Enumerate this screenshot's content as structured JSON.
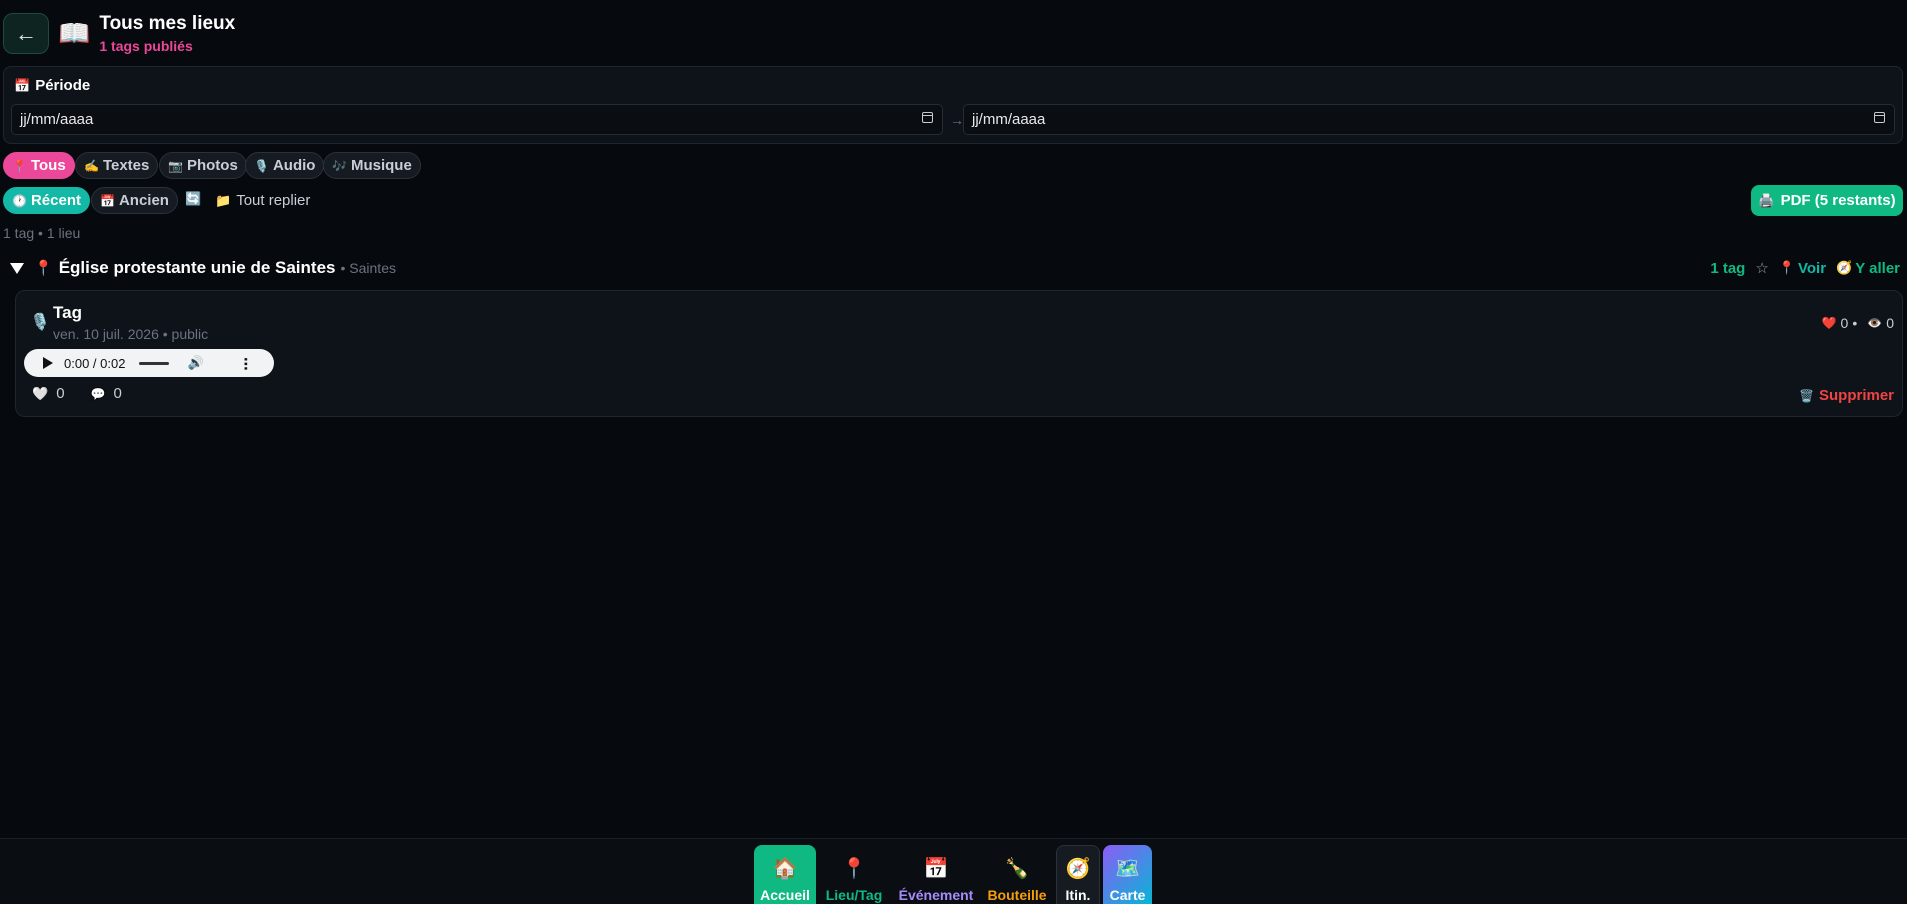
{
  "header": {
    "back_icon": "←",
    "book_icon": "📖",
    "title": "Tous mes lieux",
    "subtitle": "1 tags publiés"
  },
  "period": {
    "icon": "📅",
    "label": "Période",
    "start_value": "jj/mm/aaaa",
    "end_value": "jj/mm/aaaa",
    "separator": "→"
  },
  "type_filters": [
    {
      "icon": "📍",
      "label": "Tous"
    },
    {
      "icon": "✍️",
      "label": "Textes"
    },
    {
      "icon": "📷",
      "label": "Photos"
    },
    {
      "icon": "🎙️",
      "label": "Audio"
    },
    {
      "icon": "🎶",
      "label": "Musique"
    }
  ],
  "sort": {
    "recent": {
      "icon": "🕐",
      "label": "Récent"
    },
    "old": {
      "icon": "📅",
      "label": "Ancien"
    },
    "refresh_icon": "🔄",
    "collapse": {
      "icon": "📁",
      "label": "Tout replier"
    }
  },
  "pdf_button": {
    "icon": "🖨️",
    "label": "PDF (5 restants)"
  },
  "summary": "1 tag • 1 lieu",
  "place": {
    "pin_icon": "📍",
    "name": "Église protestante unie de Saintes",
    "city": "• Saintes",
    "tag_count": "1 tag",
    "star_icon": "☆",
    "view": {
      "icon": "📍",
      "label": "Voir"
    },
    "go": {
      "icon": "🧭",
      "label": "Y aller"
    }
  },
  "tag_card": {
    "mic_icon": "🎙️",
    "title": "Tag",
    "meta": "ven. 10 juil. 2026 • public",
    "likes_icon": "❤️",
    "likes": "0",
    "stat_sep": "•",
    "views_icon": "👁️",
    "views": "0",
    "audio_time": "0:00 / 0:02",
    "volume_icon": "🔊",
    "bottom_like_icon": "🤍",
    "bottom_likes": "0",
    "comment_icon": "💬",
    "comments": "0",
    "delete": {
      "icon": "🗑️",
      "label": "Supprimer"
    }
  },
  "nav": [
    {
      "icon": "🏠",
      "label": "Accueil"
    },
    {
      "icon": "📍",
      "label": "Lieu/Tag"
    },
    {
      "icon": "📅",
      "label": "Événement"
    },
    {
      "icon": "🍾",
      "label": "Bouteille"
    },
    {
      "icon": "🧭",
      "label": "Itin."
    },
    {
      "icon": "🗺️",
      "label": "Carte"
    }
  ],
  "colors": {
    "pink": "#ec4899",
    "teal": "#14b8a6",
    "green": "#10b981",
    "purple": "#a78bfa",
    "orange": "#f59e0b",
    "red": "#ef4444"
  }
}
